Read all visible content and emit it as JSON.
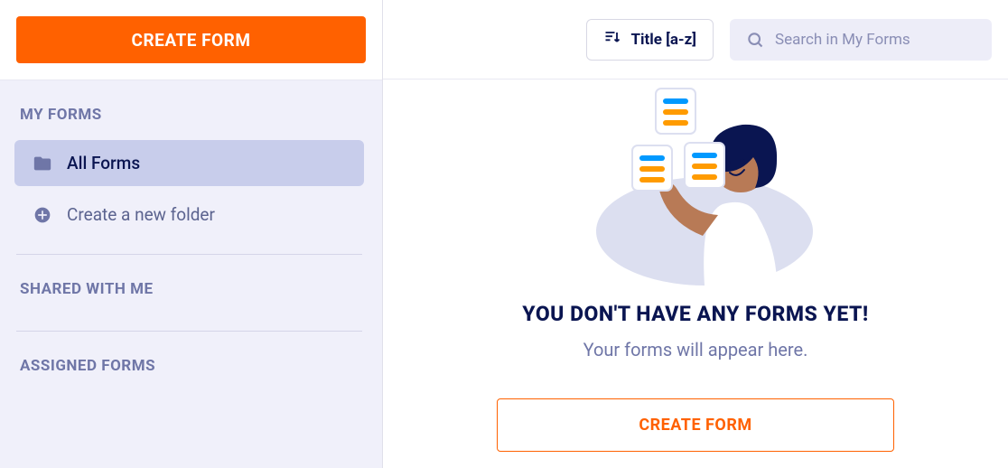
{
  "sidebar": {
    "create_button_label": "CREATE FORM",
    "sections": {
      "my_forms": {
        "header": "MY FORMS",
        "items": [
          {
            "label": "All Forms"
          },
          {
            "label": "Create a new folder"
          }
        ]
      },
      "shared_with_me": {
        "header": "SHARED WITH ME"
      },
      "assigned_forms": {
        "header": "ASSIGNED FORMS"
      }
    }
  },
  "toolbar": {
    "sort_label": "Title [a-z]",
    "search_placeholder": "Search in My Forms"
  },
  "empty_state": {
    "title": "YOU DON'T HAVE ANY FORMS YET!",
    "subtitle": "Your forms will appear here.",
    "button_label": "CREATE FORM"
  }
}
